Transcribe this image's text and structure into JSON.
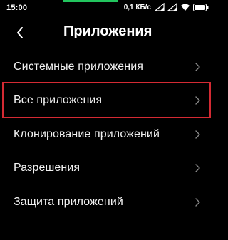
{
  "status_bar": {
    "time": "15:00",
    "network_speed": "0,1 КБ/с",
    "icons": [
      "signal-icon",
      "signal-icon",
      "wifi-icon",
      "battery-icon"
    ]
  },
  "header": {
    "back_icon": "chevron-left-icon",
    "title": "Приложения"
  },
  "menu": {
    "items": [
      {
        "label": "Системные приложения",
        "icon": "chevron-right-icon"
      },
      {
        "label": "Все приложения",
        "icon": "chevron-right-icon",
        "highlighted": true
      },
      {
        "label": "Клонирование приложений",
        "icon": "chevron-right-icon"
      },
      {
        "label": "Разрешения",
        "icon": "chevron-right-icon"
      },
      {
        "label": "Защита приложений",
        "icon": "chevron-right-icon"
      }
    ]
  },
  "colors": {
    "background": "#000000",
    "text": "#ffffff",
    "chevron": "#8a8a8a",
    "highlight_border": "#d42a33",
    "top_accent": "#22c55e"
  }
}
